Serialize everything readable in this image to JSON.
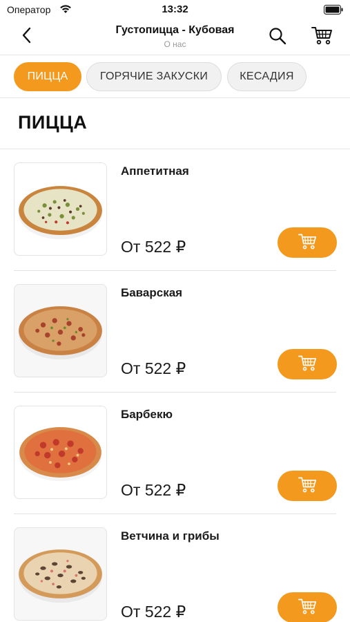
{
  "status_bar": {
    "carrier": "Оператор",
    "time": "13:32"
  },
  "nav": {
    "title": "Густопицца - Кубовая",
    "subtitle": "О нас",
    "back_icon": "chevron-left-icon",
    "search_icon": "search-icon",
    "cart_icon": "cart-icon"
  },
  "categories": [
    {
      "label": "ПИЦЦА",
      "active": true
    },
    {
      "label": "ГОРЯЧИЕ ЗАКУСКИ",
      "active": false
    },
    {
      "label": "КЕСАДИЯ",
      "active": false
    }
  ],
  "section": {
    "title": "ПИЦЦА"
  },
  "products": [
    {
      "name": "Аппетитная",
      "price": "От 522 ₽"
    },
    {
      "name": "Баварская",
      "price": "От 522 ₽"
    },
    {
      "name": "Барбекю",
      "price": "От 522 ₽"
    },
    {
      "name": "Ветчина и грибы",
      "price": "От 522 ₽"
    }
  ],
  "colors": {
    "accent": "#f39a1e",
    "chip_inactive_bg": "#f1f1f1",
    "divider": "#e6e6e6",
    "subtitle": "#9a9a9a"
  }
}
